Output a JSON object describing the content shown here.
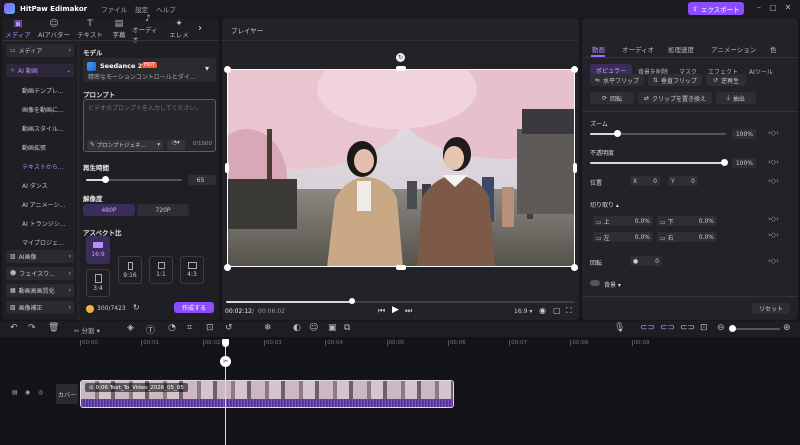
{
  "titlebar": {
    "app_name": "HitPaw Edimakor",
    "menu": [
      "ファイル",
      "設定",
      "ヘルプ"
    ],
    "export_label": "エクスポート"
  },
  "tool_tabs": [
    {
      "label": "メディア",
      "icon": "media-icon",
      "active": true
    },
    {
      "label": "AIアバター",
      "icon": "avatar-icon"
    },
    {
      "label": "テキスト",
      "icon": "text-icon"
    },
    {
      "label": "字幕",
      "icon": "subtitle-icon"
    },
    {
      "label": "オーディオ",
      "icon": "audio-icon"
    },
    {
      "label": "エレメ",
      "icon": "element-icon"
    }
  ],
  "sidebar": {
    "items": [
      {
        "label": "メディア",
        "icon": "folder-icon"
      },
      {
        "label": "AI 動画",
        "icon": "ai-video-icon",
        "active": true
      }
    ],
    "sub_items": [
      "動画テンプレ...",
      "画像を動画に...",
      "動画スタイル...",
      "動画拡張",
      "テキストから...",
      "AI ダンス",
      "AI アニメーシ...",
      "AI トランジシ...",
      "マイプロジェ..."
    ],
    "bottom_items": [
      "AI画像",
      "フェイスワ...",
      "動画高画質化",
      "画像補正"
    ]
  },
  "ai_panel": {
    "model_label": "モデル",
    "model_name": "Seedance 2.0",
    "model_badge": "HOT",
    "model_desc": "精密なモーションコントロールとダイ...",
    "prompt_label": "プロンプト",
    "prompt_placeholder": "ビデオのプロンプトを入力してください。",
    "prompt_gen_label": "プロンプトジェネ...",
    "char_count": "0/1000",
    "duration_label": "再生時間",
    "duration_value": "6S",
    "duration_fraction": 0.2,
    "resolution_label": "解像度",
    "res_options": [
      "480P",
      "720P"
    ],
    "aspect_label": "アスペクト比",
    "aspects": [
      "16:9",
      "9:16",
      "1:1",
      "4:3",
      "3:4"
    ],
    "credits": "300/7423",
    "create_label": "作成する"
  },
  "player": {
    "title": "プレイヤー",
    "time_current": "00:02:12",
    "time_total": "00:06:02",
    "ratio": "16:9",
    "progress": 0.36
  },
  "right_panel": {
    "tabs": [
      "動画",
      "オーディオ",
      "処理速度",
      "アニメーション",
      "色"
    ],
    "subtabs": [
      "ポピュラー",
      "背景を削除",
      "マスク",
      "エフェクト",
      "AIツール"
    ],
    "actions": [
      "水平フリップ",
      "垂直フリップ",
      "逆再生",
      "回転",
      "クリップを置き換え",
      "抽出"
    ],
    "zoom_label": "ズーム",
    "zoom_value": "100%",
    "zoom_fraction": 0.2,
    "opacity_label": "不透明度",
    "opacity_value": "100%",
    "opacity_fraction": 1.0,
    "position_label": "位置",
    "pos_x_label": "X",
    "pos_x": "0",
    "pos_y_label": "Y",
    "pos_y": "0",
    "crop_label": "切り取り",
    "crop": [
      {
        "label": "上",
        "value": "0.0%"
      },
      {
        "label": "下",
        "value": "0.0%"
      },
      {
        "label": "左",
        "value": "0.0%"
      },
      {
        "label": "右",
        "value": "0.0%"
      }
    ],
    "rotate_label": "回転",
    "rotate_value": "0",
    "bg_label": "背景",
    "reset_label": "リセット"
  },
  "timeline": {
    "split_label": "分割",
    "ruler": [
      "00:00",
      "00:01",
      "00:02",
      "00:03",
      "00:04",
      "00:05",
      "00:06",
      "00:07",
      "00:08",
      "00:09"
    ],
    "track_label": "カバー",
    "clip_title": "0:06 Text_To_Video_2026_05_05"
  },
  "colors": {
    "accent": "#8b4dff",
    "panel": "#222228",
    "bg": "#17171b"
  }
}
